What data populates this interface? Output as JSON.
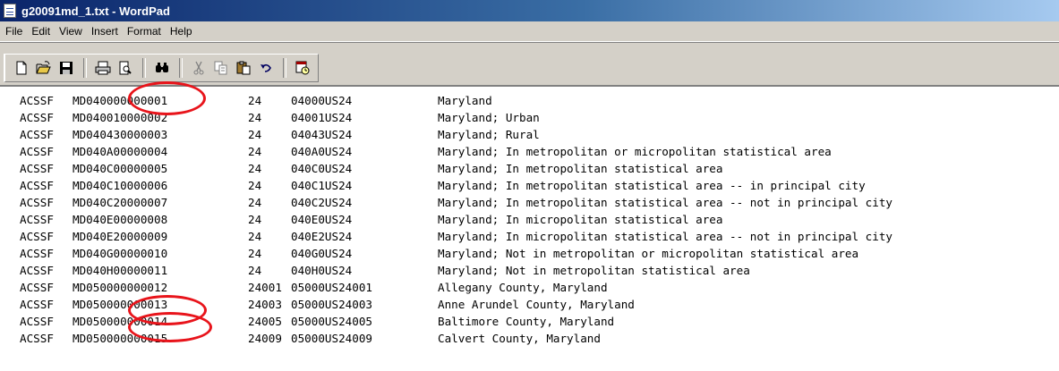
{
  "window": {
    "title": "g20091md_1.txt - WordPad"
  },
  "menu": [
    "File",
    "Edit",
    "View",
    "Insert",
    "Format",
    "Help"
  ],
  "toolbar": {
    "icons": [
      "new-icon",
      "open-icon",
      "save-icon",
      "print-icon",
      "print-preview-icon",
      "find-icon",
      "cut-icon",
      "copy-icon",
      "paste-icon",
      "undo-icon",
      "date-time-icon"
    ]
  },
  "rows": [
    [
      "ACSSF",
      "MD040000000001",
      "24",
      "04000US24",
      "Maryland"
    ],
    [
      "ACSSF",
      "MD040010000002",
      "24",
      "04001US24",
      "Maryland; Urban"
    ],
    [
      "ACSSF",
      "MD040430000003",
      "24",
      "04043US24",
      "Maryland; Rural"
    ],
    [
      "ACSSF",
      "MD040A00000004",
      "24",
      "040A0US24",
      "Maryland; In metropolitan or micropolitan statistical area"
    ],
    [
      "ACSSF",
      "MD040C00000005",
      "24",
      "040C0US24",
      "Maryland; In metropolitan statistical area"
    ],
    [
      "ACSSF",
      "MD040C10000006",
      "24",
      "040C1US24",
      "Maryland; In metropolitan statistical area -- in principal city"
    ],
    [
      "ACSSF",
      "MD040C20000007",
      "24",
      "040C2US24",
      "Maryland; In metropolitan statistical area -- not in principal city"
    ],
    [
      "ACSSF",
      "MD040E00000008",
      "24",
      "040E0US24",
      "Maryland; In micropolitan statistical area"
    ],
    [
      "ACSSF",
      "MD040E20000009",
      "24",
      "040E2US24",
      "Maryland; In micropolitan statistical area -- not in principal city"
    ],
    [
      "ACSSF",
      "MD040G00000010",
      "24",
      "040G0US24",
      "Maryland; Not in metropolitan or micropolitan statistical area"
    ],
    [
      "ACSSF",
      "MD040H00000011",
      "24",
      "040H0US24",
      "Maryland; Not in metropolitan statistical area"
    ],
    [
      "ACSSF",
      "MD050000000012",
      "24001",
      "05000US24001",
      "Allegany County, Maryland"
    ],
    [
      "ACSSF",
      "MD050000000013",
      "24003",
      "05000US24003",
      "Anne Arundel County, Maryland"
    ],
    [
      "ACSSF",
      "MD050000000014",
      "24005",
      "05000US24005",
      "Baltimore County, Maryland"
    ],
    [
      "ACSSF",
      "MD050000000015",
      "24009",
      "05000US24009",
      "Calvert County, Maryland"
    ]
  ],
  "annotation_color": "#e8141b"
}
